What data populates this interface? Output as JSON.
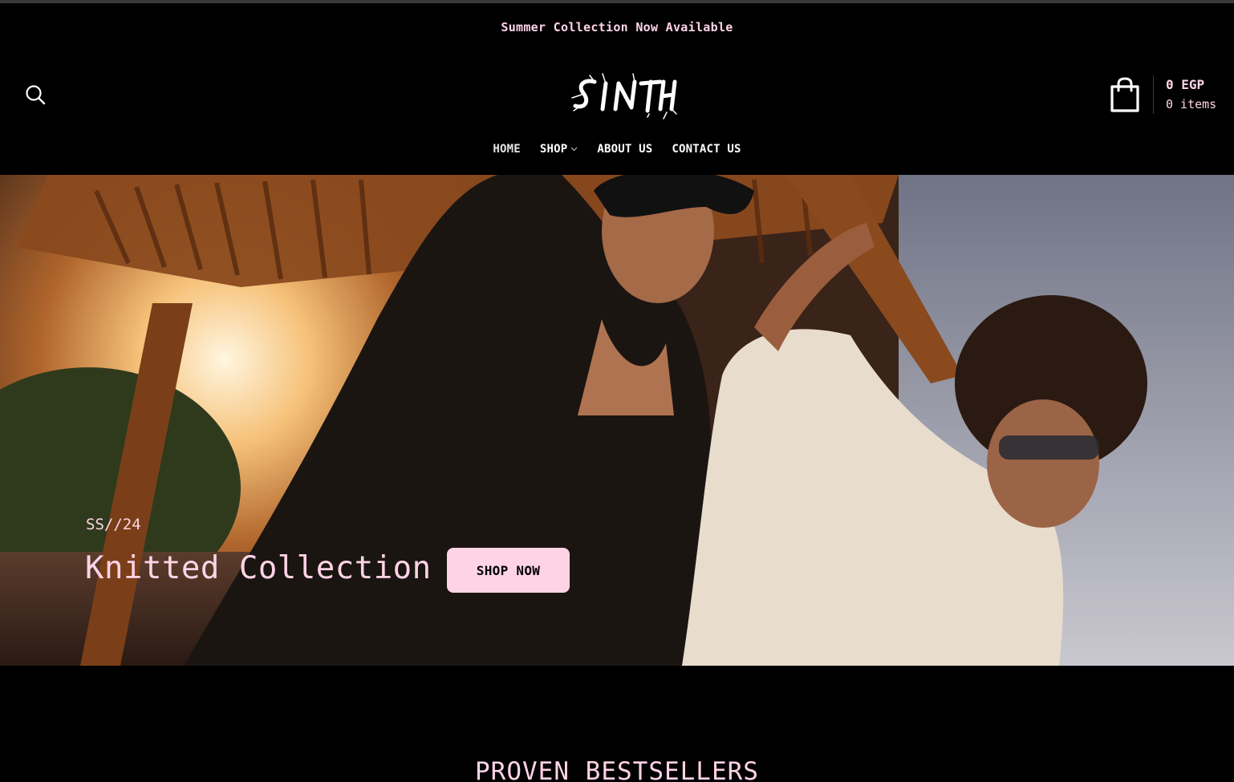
{
  "announcement": "Summer Collection Now Available",
  "header": {
    "logo_text": "SINTH",
    "cart": {
      "total": "0 EGP",
      "items": "0 items"
    }
  },
  "nav": {
    "items": [
      {
        "label": "HOME"
      },
      {
        "label": "SHOP"
      },
      {
        "label": "ABOUT US"
      },
      {
        "label": "CONTACT US"
      }
    ]
  },
  "hero": {
    "kicker": "SS//24",
    "title": "Knitted Collection",
    "cta": "SHOP NOW"
  },
  "sections": {
    "bestsellers_title": "PROVEN BESTSELLERS"
  },
  "colors": {
    "accent": "#ffd3e6",
    "background": "#000000"
  },
  "icons": [
    "search-icon",
    "shopping-bag-icon",
    "chevron-down-icon"
  ]
}
